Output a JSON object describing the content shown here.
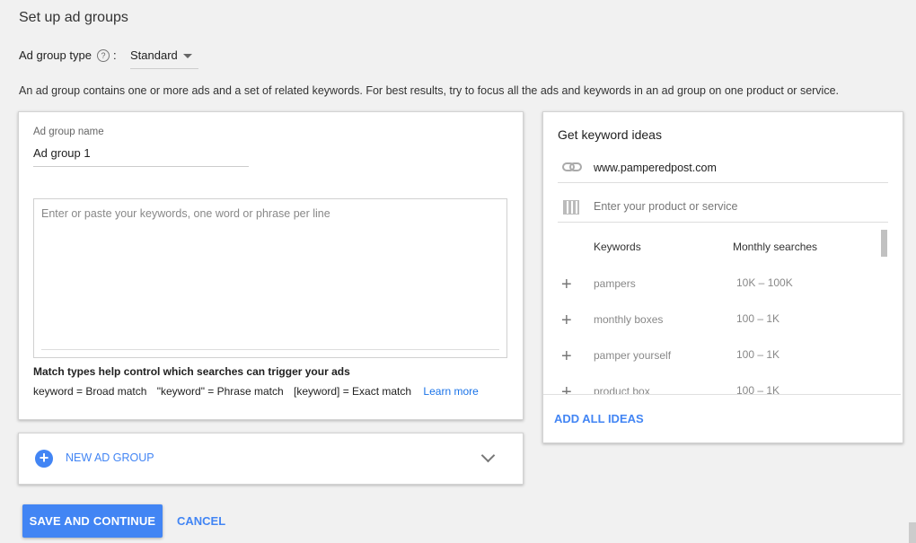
{
  "page": {
    "title": "Set up ad groups",
    "ad_group_type_label": "Ad group type",
    "help_glyph": "?",
    "colon": ":",
    "ad_group_type_value": "Standard",
    "description": "An ad group contains one or more ads and a set of related keywords. For best results, try to focus all the ads and keywords in an ad group on one product or service."
  },
  "ad_group": {
    "name_label": "Ad group name",
    "name_value": "Ad group 1",
    "keywords_placeholder": "Enter or paste your keywords, one word or phrase per line",
    "match_title": "Match types help control which searches can trigger your ads",
    "broad": "keyword = Broad match",
    "phrase": "\"keyword\" = Phrase match",
    "exact": "[keyword] = Exact match",
    "learn_more": "Learn more"
  },
  "new_ad_group": {
    "plus_glyph": "+",
    "label": "NEW AD GROUP"
  },
  "actions": {
    "save": "SAVE AND CONTINUE",
    "cancel": "CANCEL"
  },
  "keyword_ideas": {
    "title": "Get keyword ideas",
    "url": "www.pamperedpost.com",
    "product_placeholder": "Enter your product or service",
    "col_keywords": "Keywords",
    "col_monthly": "Monthly searches",
    "add_glyph": "+",
    "rows": [
      {
        "keyword": "pampers",
        "searches": "10K – 100K"
      },
      {
        "keyword": "monthly boxes",
        "searches": "100 – 1K"
      },
      {
        "keyword": "pamper yourself",
        "searches": "100 – 1K"
      },
      {
        "keyword": "product box",
        "searches": "100 – 1K"
      }
    ],
    "add_all": "ADD ALL IDEAS"
  },
  "colors": {
    "accent": "#4285f4",
    "link": "#1a73e8",
    "background": "#f1f1f1"
  },
  "icons": [
    "help-icon",
    "caret-down-icon",
    "add-circle-icon",
    "chevron-down-icon",
    "link-icon",
    "building-icon",
    "add-icon"
  ]
}
